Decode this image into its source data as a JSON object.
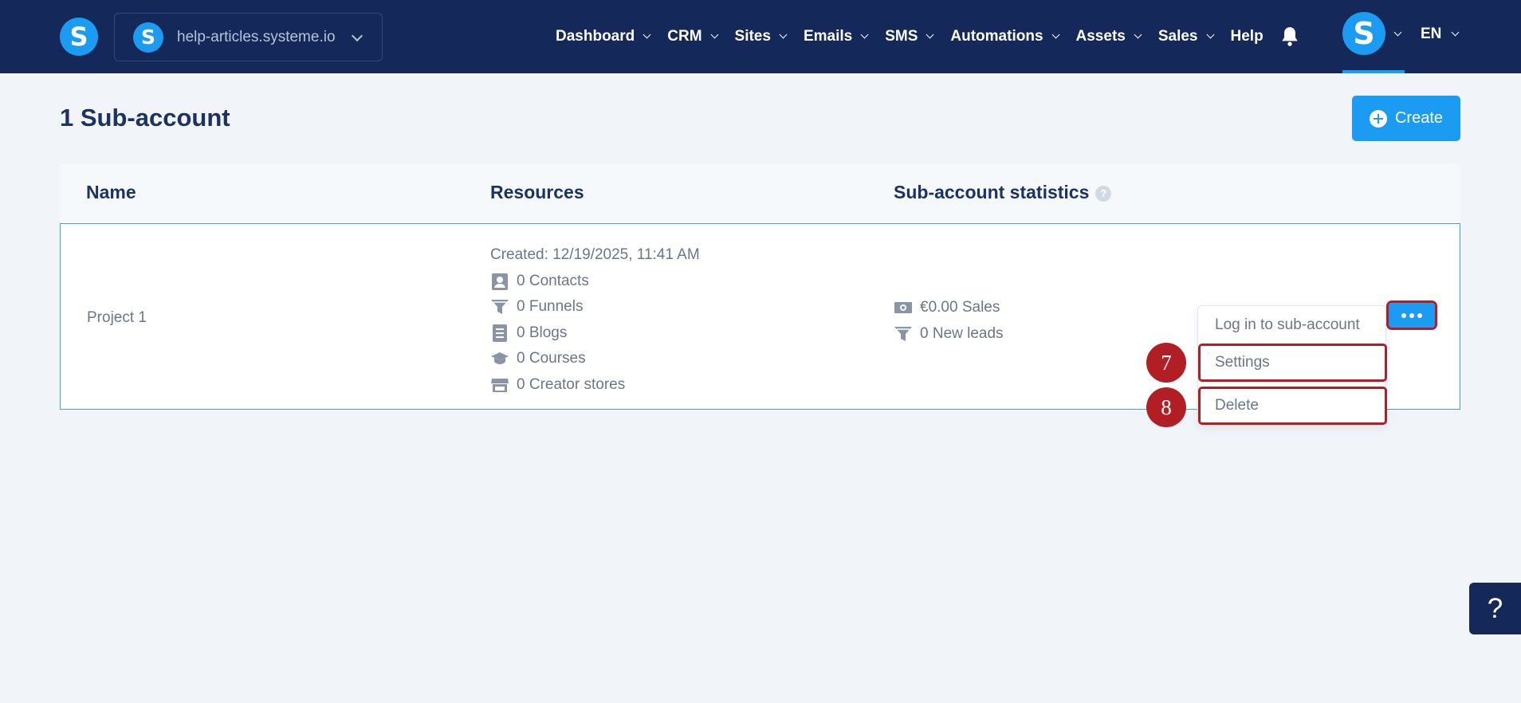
{
  "brand": {
    "logo_letter": "S"
  },
  "site_selector": {
    "avatar_letter": "S",
    "site": "help-articles.systeme.io"
  },
  "nav": {
    "items": [
      {
        "label": "Dashboard"
      },
      {
        "label": "CRM"
      },
      {
        "label": "Sites"
      },
      {
        "label": "Emails"
      },
      {
        "label": "SMS"
      },
      {
        "label": "Automations"
      },
      {
        "label": "Assets"
      },
      {
        "label": "Sales"
      }
    ],
    "help": "Help",
    "user_letter": "S",
    "language": "EN"
  },
  "page": {
    "title": "1 Sub-account",
    "create_label": "Create"
  },
  "table": {
    "headers": {
      "name": "Name",
      "resources": "Resources",
      "statistics": "Sub-account statistics",
      "info": "?"
    },
    "row": {
      "name": "Project 1",
      "created": "Created: 12/19/2025, 11:41 AM",
      "resources": [
        {
          "icon": "contacts-icon",
          "text": "0 Contacts"
        },
        {
          "icon": "funnel-icon",
          "text": "0 Funnels"
        },
        {
          "icon": "blog-icon",
          "text": "0 Blogs"
        },
        {
          "icon": "course-icon",
          "text": "0 Courses"
        },
        {
          "icon": "store-icon",
          "text": "0 Creator stores"
        }
      ],
      "stats": [
        {
          "icon": "money-icon",
          "text": "€0.00 Sales"
        },
        {
          "icon": "funnel-icon",
          "text": "0 New leads"
        }
      ]
    }
  },
  "menu": {
    "items": [
      "Log in to sub-account",
      "Settings",
      "Delete"
    ]
  },
  "steps": {
    "settings": "7",
    "delete": "8"
  },
  "help_fab": "?",
  "colors": {
    "nav_bg": "#14295a",
    "accent": "#1b9cf2",
    "highlight": "#b11f24",
    "page_bg": "#f1f5f9"
  }
}
